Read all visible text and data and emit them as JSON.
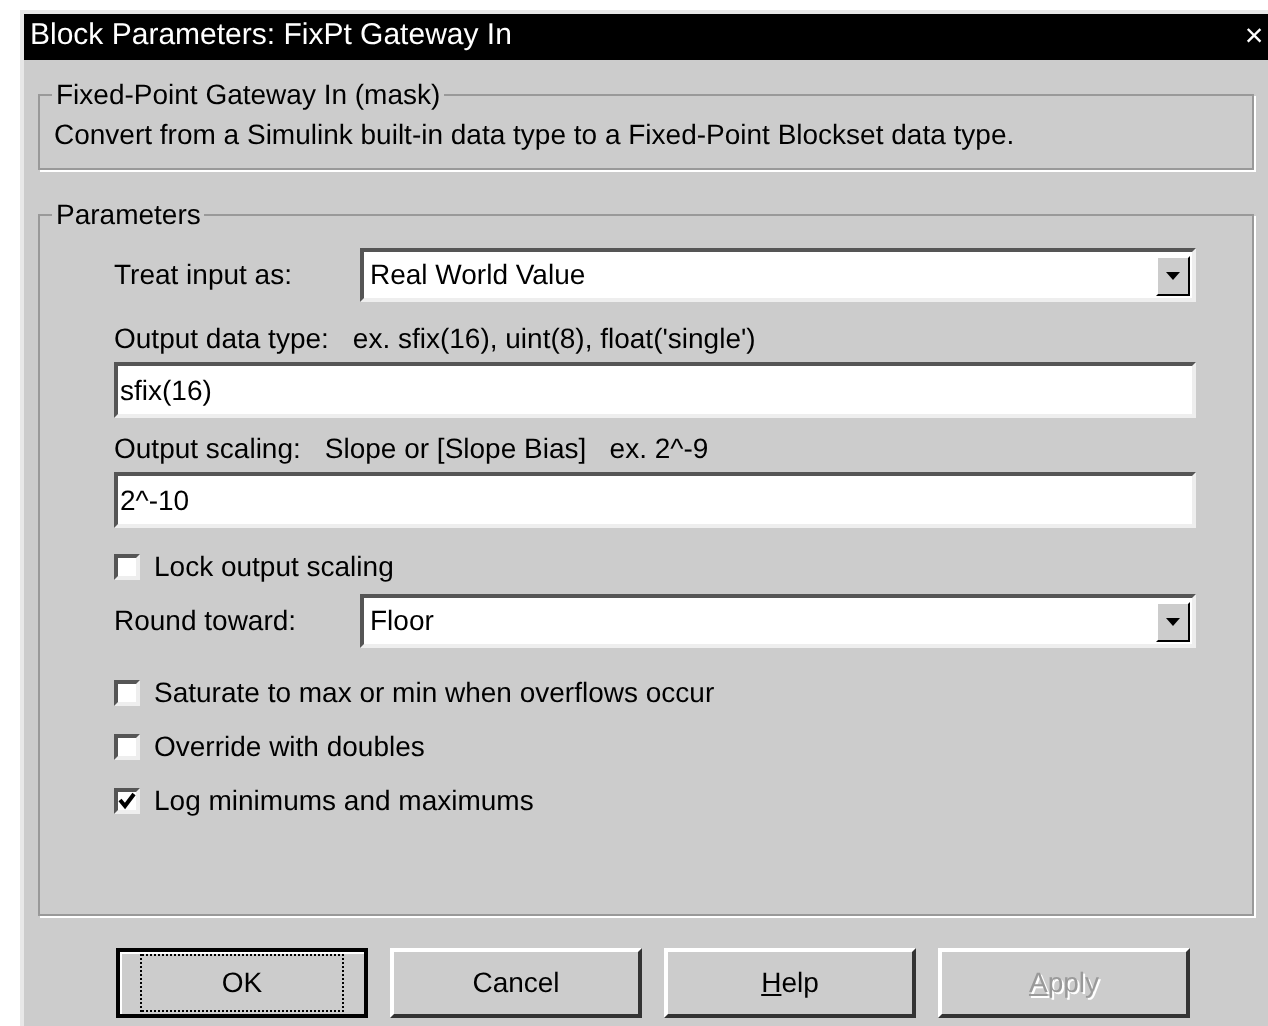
{
  "window": {
    "title": "Block Parameters: FixPt Gateway In",
    "close": "×"
  },
  "description_group": {
    "title": "Fixed-Point Gateway In (mask)",
    "text": "Convert from a Simulink built-in data type to a Fixed-Point Blockset data type."
  },
  "parameters": {
    "title": "Parameters",
    "items": [
      {
        "kind": "dropdown",
        "label": "Treat input as:",
        "value": "Real World Value"
      },
      {
        "kind": "field",
        "label": "Output data type:",
        "hint": "ex. sfix(16), uint(8), float('single')",
        "value": "sfix(16)"
      },
      {
        "kind": "field",
        "label": "Output scaling:",
        "hint": "Slope or [Slope Bias]   ex. 2^-9",
        "value": "2^-10"
      },
      {
        "kind": "checkbox",
        "label": "Lock output scaling",
        "checked": false
      },
      {
        "kind": "dropdown",
        "label": "Round toward:",
        "value": "Floor"
      },
      {
        "kind": "checkbox",
        "label": "Saturate to max or min when overflows occur",
        "checked": false
      },
      {
        "kind": "checkbox",
        "label": "Override with doubles",
        "checked": false
      },
      {
        "kind": "checkbox",
        "label": "Log minimums and maximums",
        "checked": true
      }
    ]
  },
  "buttons": [
    {
      "label": "OK",
      "focused": true,
      "disabled": false
    },
    {
      "label": "Cancel",
      "focused": false,
      "disabled": false
    },
    {
      "label": "Help",
      "focused": false,
      "disabled": false,
      "underline_first": true
    },
    {
      "label": "Apply",
      "focused": false,
      "disabled": true,
      "underline_first": true
    }
  ]
}
